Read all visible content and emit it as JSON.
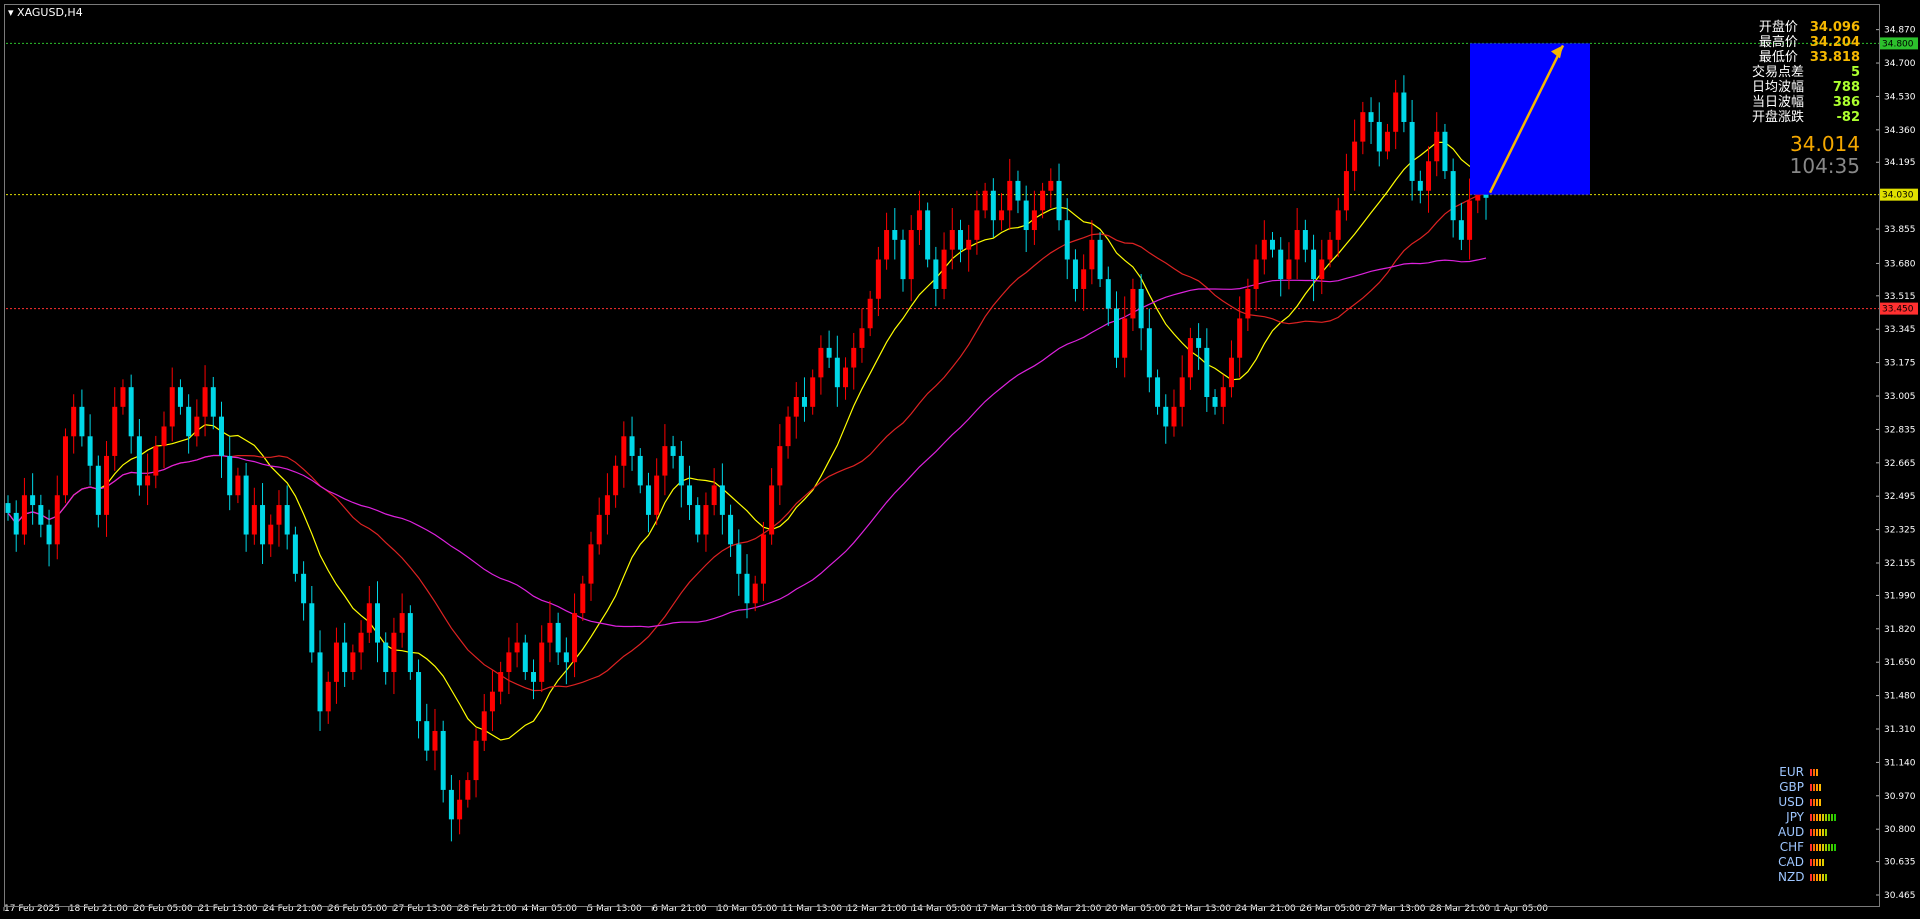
{
  "symbol": "XAGUSD,H4",
  "info": {
    "rows": [
      {
        "label": "开盘价",
        "value": "34.096",
        "color": "orange"
      },
      {
        "label": "最高价",
        "value": "34.204",
        "color": "orange"
      },
      {
        "label": "最低价",
        "value": "33.818",
        "color": "orange"
      },
      {
        "label": "交易点差",
        "value": "5",
        "color": "green"
      },
      {
        "label": "日均波幅",
        "value": "788",
        "color": "green"
      },
      {
        "label": "当日波幅",
        "value": "386",
        "color": "green"
      },
      {
        "label": "开盘涨跌",
        "value": "-82",
        "color": "green"
      }
    ],
    "price": "34.014",
    "timer": "104:35"
  },
  "currencies": [
    {
      "name": "EUR",
      "bars": 3
    },
    {
      "name": "GBP",
      "bars": 4
    },
    {
      "name": "USD",
      "bars": 4
    },
    {
      "name": "JPY",
      "bars": 9
    },
    {
      "name": "AUD",
      "bars": 6
    },
    {
      "name": "CHF",
      "bars": 9
    },
    {
      "name": "CAD",
      "bars": 5
    },
    {
      "name": "NZD",
      "bars": 6
    }
  ],
  "colors": {
    "bull": "#ff0000",
    "bear": "#00d8e8",
    "ma_yellow": "#ffff00",
    "ma_red": "#dd2222",
    "ma_magenta": "#dd22dd",
    "target_box": "#0000ff",
    "arrow": "#f5b800",
    "green_line": "#2cc02c",
    "red_line": "#ff3030",
    "price_line": "#e0e000"
  },
  "chart_data": {
    "type": "candlestick",
    "title": "XAGUSD,H4",
    "ylim": [
      30.465,
      34.97
    ],
    "y_ticks": [
      34.87,
      34.7,
      34.53,
      34.36,
      34.195,
      33.855,
      33.68,
      33.515,
      33.345,
      33.175,
      33.005,
      32.835,
      32.665,
      32.495,
      32.325,
      32.155,
      31.99,
      31.82,
      31.65,
      31.48,
      31.31,
      31.14,
      30.97,
      30.8,
      30.635,
      30.465
    ],
    "x_ticks": [
      "17 Feb 2025",
      "18 Feb 21:00",
      "20 Feb 05:00",
      "21 Feb 13:00",
      "24 Feb 21:00",
      "26 Feb 05:00",
      "27 Feb 13:00",
      "28 Feb 21:00",
      "4 Mar 05:00",
      "5 Mar 13:00",
      "6 Mar 21:00",
      "10 Mar 05:00",
      "11 Mar 13:00",
      "12 Mar 21:00",
      "14 Mar 05:00",
      "17 Mar 13:00",
      "18 Mar 21:00",
      "20 Mar 05:00",
      "21 Mar 13:00",
      "24 Mar 21:00",
      "26 Mar 05:00",
      "27 Mar 13:00",
      "28 Mar 21:00",
      "1 Apr 05:00"
    ],
    "levels": [
      {
        "value": 34.8,
        "label": "34.800",
        "style": "green-dashed"
      },
      {
        "value": 34.03,
        "label": "34.030",
        "style": "price"
      },
      {
        "value": 33.45,
        "label": "33.450",
        "style": "red-dashed"
      }
    ],
    "closes": [
      32.41,
      32.3,
      32.5,
      32.45,
      32.35,
      32.25,
      32.5,
      32.8,
      32.95,
      32.8,
      32.65,
      32.4,
      32.7,
      32.95,
      33.05,
      32.8,
      32.55,
      32.6,
      32.75,
      32.85,
      33.05,
      32.95,
      32.8,
      32.9,
      33.05,
      32.9,
      32.7,
      32.5,
      32.6,
      32.3,
      32.45,
      32.25,
      32.35,
      32.45,
      32.3,
      32.1,
      31.95,
      31.7,
      31.4,
      31.55,
      31.75,
      31.6,
      31.7,
      31.8,
      31.95,
      31.75,
      31.6,
      31.8,
      31.9,
      31.6,
      31.35,
      31.2,
      31.3,
      31.0,
      30.85,
      30.95,
      31.05,
      31.25,
      31.4,
      31.5,
      31.6,
      31.7,
      31.75,
      31.6,
      31.55,
      31.75,
      31.85,
      31.7,
      31.65,
      31.9,
      32.05,
      32.25,
      32.4,
      32.5,
      32.65,
      32.8,
      32.7,
      32.55,
      32.4,
      32.6,
      32.75,
      32.7,
      32.55,
      32.45,
      32.3,
      32.45,
      32.55,
      32.4,
      32.25,
      32.1,
      31.95,
      32.05,
      32.3,
      32.55,
      32.75,
      32.9,
      33.0,
      32.95,
      33.1,
      33.25,
      33.2,
      33.05,
      33.15,
      33.25,
      33.35,
      33.5,
      33.7,
      33.85,
      33.8,
      33.6,
      33.85,
      33.95,
      33.7,
      33.55,
      33.75,
      33.85,
      33.75,
      33.8,
      33.95,
      34.05,
      33.9,
      33.95,
      34.1,
      34.0,
      33.85,
      33.95,
      34.05,
      34.1,
      33.9,
      33.7,
      33.55,
      33.65,
      33.8,
      33.6,
      33.45,
      33.2,
      33.4,
      33.55,
      33.35,
      33.1,
      32.95,
      32.85,
      32.95,
      33.1,
      33.3,
      33.25,
      33.0,
      32.95,
      33.05,
      33.2,
      33.4,
      33.55,
      33.7,
      33.8,
      33.75,
      33.6,
      33.7,
      33.85,
      33.75,
      33.6,
      33.7,
      33.8,
      33.95,
      34.15,
      34.3,
      34.45,
      34.4,
      34.25,
      34.35,
      34.55,
      34.4,
      34.1,
      34.05,
      34.2,
      34.35,
      34.15,
      33.9,
      33.8,
      34.0,
      34.1,
      34.014
    ]
  }
}
